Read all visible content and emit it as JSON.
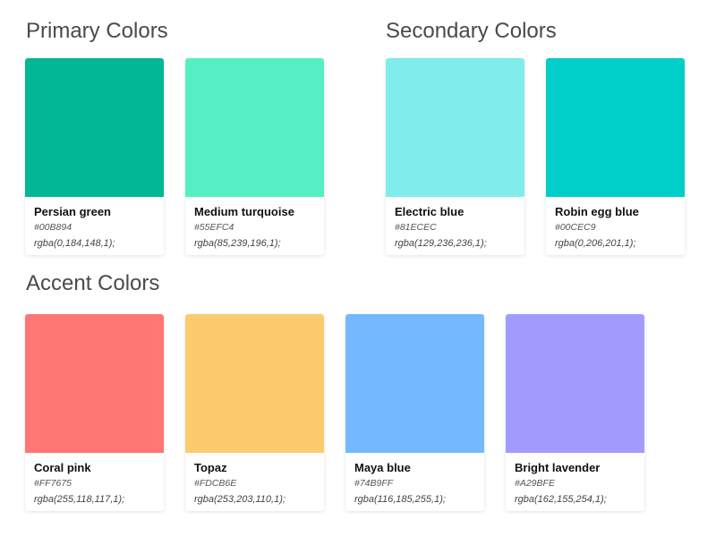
{
  "sections": {
    "primary": {
      "title": "Primary Colors",
      "colors": [
        {
          "name": "Persian green",
          "hex": "#00B894",
          "rgba": "rgba(0,184,148,1);"
        },
        {
          "name": "Medium turquoise",
          "hex": "#55EFC4",
          "rgba": "rgba(85,239,196,1);"
        }
      ]
    },
    "secondary": {
      "title": "Secondary Colors",
      "colors": [
        {
          "name": "Electric blue",
          "hex": "#81ECEC",
          "rgba": "rgba(129,236,236,1);"
        },
        {
          "name": "Robin egg blue",
          "hex": "#00CEC9",
          "rgba": "rgba(0,206,201,1);"
        }
      ]
    },
    "accent": {
      "title": "Accent Colors",
      "colors": [
        {
          "name": "Coral pink",
          "hex": "#FF7675",
          "rgba": "rgba(255,118,117,1);"
        },
        {
          "name": "Topaz",
          "hex": "#FDCB6E",
          "rgba": "rgba(253,203,110,1);"
        },
        {
          "name": "Maya blue",
          "hex": "#74B9FF",
          "rgba": "rgba(116,185,255,1);"
        },
        {
          "name": "Bright lavender",
          "hex": "#A29BFE",
          "rgba": "rgba(162,155,254,1);"
        }
      ]
    }
  }
}
